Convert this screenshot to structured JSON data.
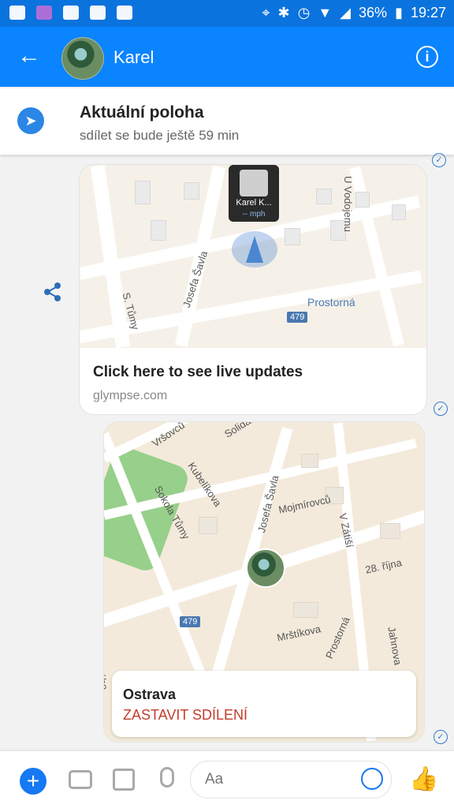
{
  "status_bar": {
    "battery": "36%",
    "time": "19:27"
  },
  "header": {
    "name": "Karel"
  },
  "location_banner": {
    "title": "Aktuální poloha",
    "subtitle": "sdílet se bude ještě 59 min"
  },
  "live_card": {
    "map_labels": [
      "U Vodojemu",
      "S. Tůmy",
      "Josefa Šavla",
      "Prostorná"
    ],
    "road_badge": "479",
    "pin_name": "Karel K...",
    "pin_speed": "-- mph",
    "cta": "Click here to see live updates",
    "domain": "glympse.com"
  },
  "location_card": {
    "map_labels": [
      "Vršovců",
      "Solidar.",
      "Kubelíkova",
      "Sokola Tůmy",
      "Josefa Šavla",
      "Mojmírovců",
      "V Zátiší",
      "28. října",
      "Mrštíkova",
      "Prostorná",
      "Jahnova",
      "rého"
    ],
    "road_badge": "479",
    "place": "Ostrava",
    "stop_label": "ZASTAVIT SDÍLENÍ"
  },
  "composer": {
    "placeholder": "Aa"
  }
}
